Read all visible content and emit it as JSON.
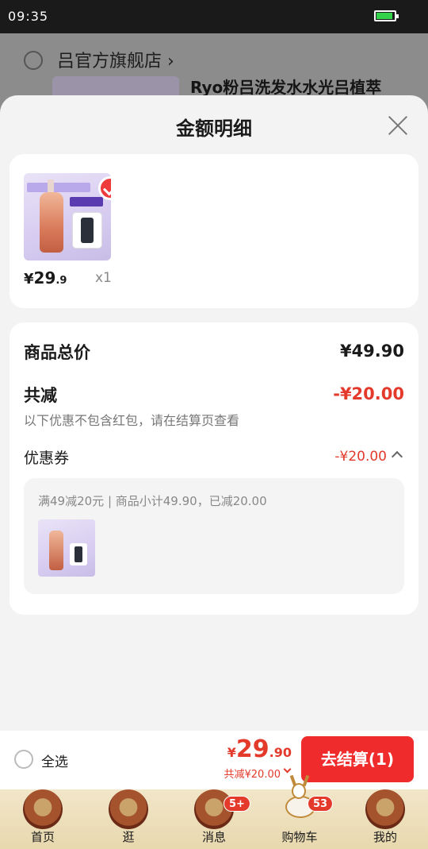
{
  "status_bar": {
    "time": "09:35"
  },
  "background": {
    "shop_name": "吕官方旗舰店 ›",
    "product_title": "Ryo粉吕洗发水水光吕植萃"
  },
  "sheet": {
    "title": "金额明细",
    "item": {
      "price_currency": "¥",
      "price_integer": "29",
      "price_decimal": ".9",
      "quantity": "x1"
    },
    "summary": {
      "total_label": "商品总价",
      "total_value": "¥49.90",
      "discount_label": "共减",
      "discount_value": "-¥20.00",
      "discount_note": "以下优惠不包含红包，请在结算页查看",
      "coupon_label": "优惠券",
      "coupon_value": "-¥20.00",
      "coupon_detail": "满49减20元 | 商品小计49.90，已减20.00"
    }
  },
  "checkout_bar": {
    "select_all_label": "全选",
    "total_currency": "¥",
    "total_integer": "29",
    "total_decimal": ".90",
    "saved_text": "共减¥20.00",
    "checkout_label": "去结算(1)"
  },
  "tab_bar": {
    "tabs": [
      {
        "label": "首页",
        "icon": "palace-icon"
      },
      {
        "label": "逛",
        "icon": "figure-icon"
      },
      {
        "label": "消息",
        "icon": "bird-icon",
        "badge": "5+"
      },
      {
        "label": "购物车",
        "icon": "deer-cart-icon",
        "badge": "53"
      },
      {
        "label": "我的",
        "icon": "compass-icon"
      }
    ]
  },
  "colors": {
    "accent_red": "#e33a2b",
    "button_red": "#ef2b2b",
    "battery_green": "#33d24a"
  }
}
